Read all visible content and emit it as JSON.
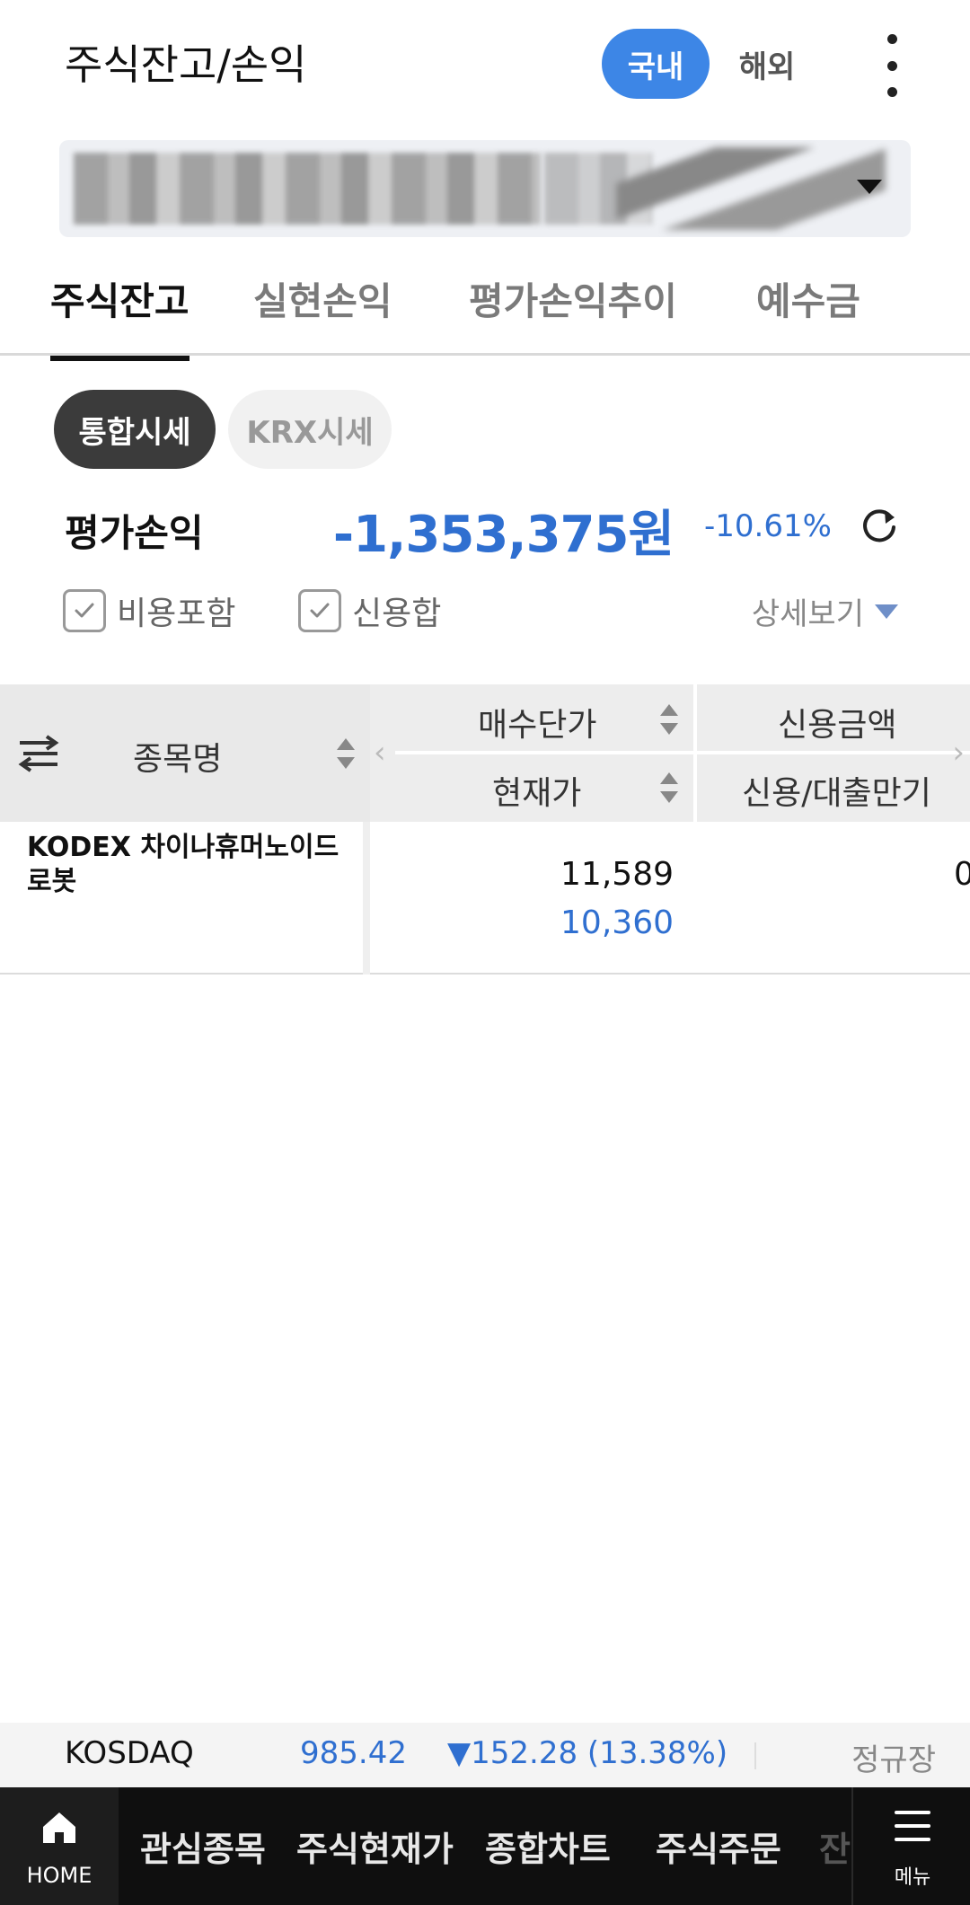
{
  "header": {
    "title": "주식잔고/손익",
    "market_on": "국내",
    "market_off": "해외"
  },
  "tabs": [
    {
      "label": "주식잔고",
      "active": true
    },
    {
      "label": "실현손익",
      "active": false
    },
    {
      "label": "평가손익추이",
      "active": false
    },
    {
      "label": "예수금",
      "active": false
    }
  ],
  "quote_chips": {
    "integrated": "통합시세",
    "krx": "KRX시세"
  },
  "summary": {
    "label": "평가손익",
    "amount": "-1,353,375원",
    "rate": "-10.61%",
    "accent": "#2f6fd0"
  },
  "options": {
    "include_cost": "비용포함",
    "credit_sum": "신용합",
    "detail": "상세보기"
  },
  "table": {
    "columns": {
      "name": "종목명",
      "buy_price": "매수단가",
      "current_price": "현재가",
      "credit_amount": "신용금액",
      "credit_due": "신용/대출만기"
    },
    "rows": [
      {
        "name": "KODEX 차이나휴머노이드로봇",
        "buy_price": "11,589",
        "current_price": "10,360",
        "credit_amount": "0"
      }
    ]
  },
  "ticker": {
    "name": "KOSDAQ",
    "value": "985.42",
    "change": "▼152.28 (13.38%)",
    "status": "정규장"
  },
  "bottom_nav": {
    "home": "HOME",
    "items": [
      "관심종목",
      "주식현재가",
      "종합차트",
      "주식주문",
      "잔"
    ],
    "menu": "메뉴"
  }
}
